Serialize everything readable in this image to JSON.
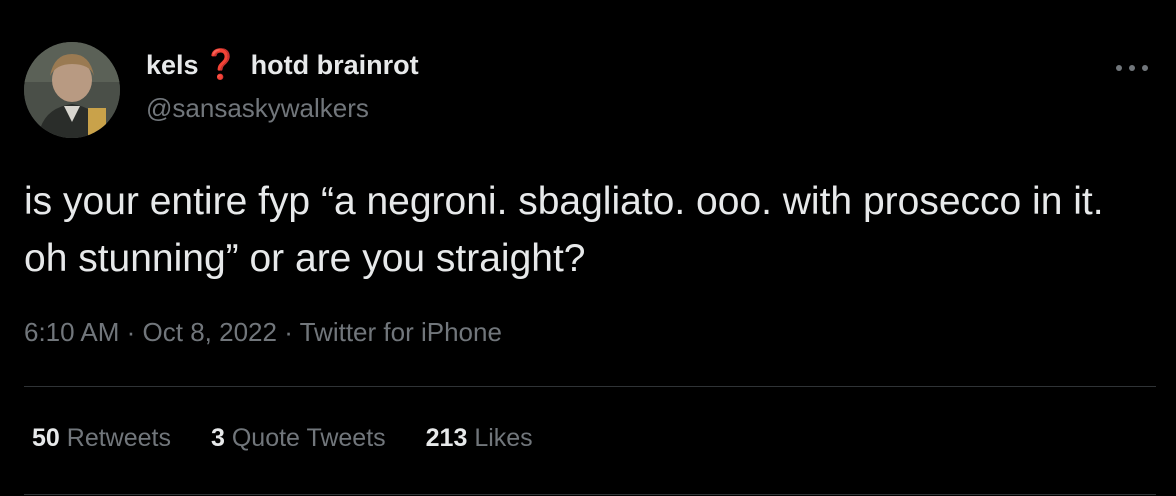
{
  "author": {
    "name": "kels",
    "emoji": "❓",
    "name_suffix": "hotd brainrot",
    "handle": "@sansaskywalkers"
  },
  "tweet": {
    "text": "is your entire fyp “a negroni. sbagliato. ooo. with prosecco in it. oh stunning” or are you straight?",
    "time": "6:10 AM",
    "date": "Oct 8, 2022",
    "source": "Twitter for iPhone",
    "separator": "·"
  },
  "stats": {
    "retweets": {
      "count": "50",
      "label": "Retweets"
    },
    "quotes": {
      "count": "3",
      "label": "Quote Tweets"
    },
    "likes": {
      "count": "213",
      "label": "Likes"
    }
  },
  "icons": {
    "more": "more-options-icon",
    "avatar": "profile-avatar"
  },
  "colors": {
    "background": "#000000",
    "text_primary": "#e7e9ea",
    "text_secondary": "#71767b",
    "divider": "#2f3336",
    "emoji_red": "#e0202c"
  }
}
